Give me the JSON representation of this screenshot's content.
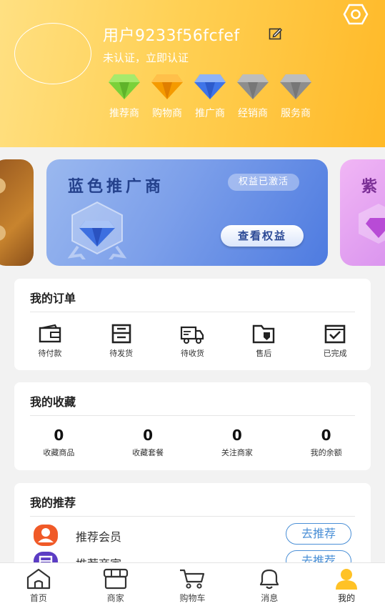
{
  "profile": {
    "username": "用户9233f56fcfef",
    "verify_text": "未认证，立即认证",
    "levels": [
      {
        "label": "推荐商",
        "color": "#7bd13a"
      },
      {
        "label": "购物商",
        "color": "#f7a600"
      },
      {
        "label": "推广商",
        "color": "#4f86f0"
      },
      {
        "label": "经销商",
        "color": "#9b9b9b"
      },
      {
        "label": "服务商",
        "color": "#9b9b9b"
      }
    ]
  },
  "banner": {
    "title": "蓝色推广商",
    "badge": "权益已激活",
    "button": "查看权益",
    "next_card_title": "紫"
  },
  "orders": {
    "title": "我的订单",
    "items": [
      {
        "label": "待付款",
        "icon": "wallet-icon"
      },
      {
        "label": "待发货",
        "icon": "package-icon"
      },
      {
        "label": "待收货",
        "icon": "truck-icon"
      },
      {
        "label": "售后",
        "icon": "after-sales-icon"
      },
      {
        "label": "已完成",
        "icon": "check-icon"
      }
    ]
  },
  "favorites": {
    "title": "我的收藏",
    "items": [
      {
        "value": "0",
        "label": "收藏商品"
      },
      {
        "value": "0",
        "label": "收藏套餐"
      },
      {
        "value": "0",
        "label": "关注商家"
      },
      {
        "value": "0",
        "label": "我的余额"
      }
    ]
  },
  "recommend": {
    "title": "我的推荐",
    "items": [
      {
        "label": "推荐会员",
        "button": "去推荐",
        "icon_color": "#f05a28"
      },
      {
        "label": "推荐商家",
        "button": "去推荐",
        "icon_color": "#5b3cc4"
      }
    ]
  },
  "tabbar": {
    "items": [
      {
        "label": "首页",
        "icon": "home-icon"
      },
      {
        "label": "商家",
        "icon": "store-icon"
      },
      {
        "label": "购物车",
        "icon": "cart-icon"
      },
      {
        "label": "消息",
        "icon": "bell-icon"
      },
      {
        "label": "我的",
        "icon": "user-icon"
      }
    ],
    "active": "我的"
  }
}
